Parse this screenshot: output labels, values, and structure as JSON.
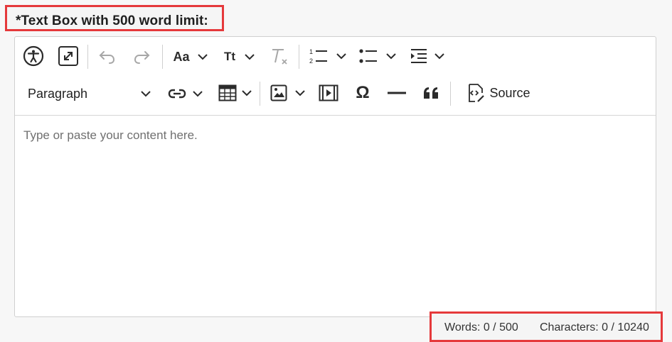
{
  "field": {
    "label": "*Text Box with 500 word limit:"
  },
  "toolbar": {
    "row1": [
      {
        "name": "accessibility-help",
        "icon": "accessibility-icon"
      },
      {
        "name": "fullscreen",
        "icon": "expand-icon"
      },
      {
        "name": "undo",
        "icon": "undo-icon",
        "disabled": true
      },
      {
        "name": "redo",
        "icon": "redo-icon",
        "disabled": true
      },
      {
        "name": "font-family",
        "icon": "font-family-icon"
      },
      {
        "name": "font-size",
        "icon": "font-size-icon"
      },
      {
        "name": "remove-format",
        "icon": "remove-format-icon",
        "disabled": true
      },
      {
        "name": "numbered-list",
        "icon": "numbered-list-icon"
      },
      {
        "name": "bulleted-list",
        "icon": "bulleted-list-icon"
      },
      {
        "name": "indent",
        "icon": "indent-icon"
      }
    ],
    "paragraph_label": "Paragraph",
    "source_label": "Source",
    "font_family_glyph": "Aa",
    "font_size_glyph": "Tt",
    "special_char_glyph": "Ω",
    "quote_glyph": "❝"
  },
  "editor": {
    "placeholder": "Type or paste your content here."
  },
  "counters": {
    "words": "Words: 0 / 500",
    "characters": "Characters: 0 / 10240"
  }
}
